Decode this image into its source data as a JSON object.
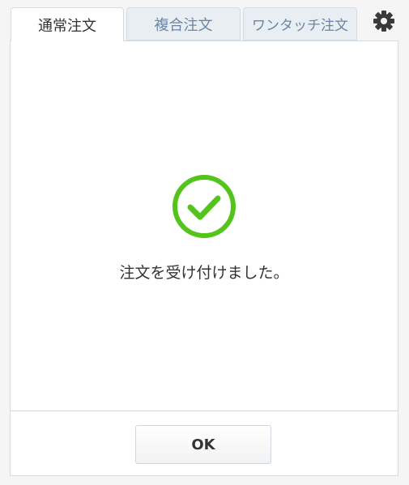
{
  "tabs": [
    {
      "label": "通常注文",
      "active": true
    },
    {
      "label": "複合注文",
      "active": false
    },
    {
      "label": "ワンタッチ注文",
      "active": false
    }
  ],
  "toolbar": {
    "settings_icon": "gear-icon"
  },
  "dialog": {
    "status_icon": "check-circle-icon",
    "message": "注文を受け付けました。",
    "ok_label": "OK"
  },
  "colors": {
    "success": "#52c41a",
    "tab_inactive_text": "#6b86a4",
    "text": "#333333"
  }
}
